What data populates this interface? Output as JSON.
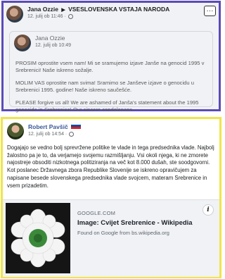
{
  "post1": {
    "author": "Jana Ozzie",
    "group": "VSESLOVENSKA VSTAJA NARODA",
    "arrow": "▶",
    "timestamp": "12. julij ob 11:46 ·",
    "more_label": "···",
    "shared": {
      "author": "Jana Ozzie",
      "timestamp": "12. julij ob 10:49",
      "paragraphs": [
        "PROSIM oprostite vsem nam! Mi se sramujemo izjave Janše na genocid 1995 v Srebrenici! Naše iskreno sožalje.",
        "MOLIM VAS oprostite nam svima! Sramimo se Janševe izjave o genocidu u Srebrenici 1995. godine! Naše iskreno saučešće.",
        "PLEASE forgive us all! We are ashamed of Janša's statement about the 1995 genocide in Srebrenica! Our sincere condolences."
      ]
    }
  },
  "post2": {
    "author": "Robert Pavšič",
    "timestamp": "12. julij ob 14:54 ·",
    "body": [
      "Dogajajo se vedno bolj sprevržene politike te vlade in tega predsednika vlade. Najbolj žalostno pa je to, da verjamejo svojemu razmišljanju. Vsi okoli njega, ki ne zmorete najostreje obsoditi nizkotnega politiziranja na več kot 8.000 dušah, ste soodgovorni.",
      "Kot poslanec Državnega zbora Republike Slovenije se iskreno opravičujem za napisane besede slovenskega predsednika vlade svojcem, materam Srebrenice in vsem prizadetim."
    ],
    "link": {
      "domain": "GOOGLE.COM",
      "title": "Image: Cvijet Srebrenice - Wikipedia",
      "description": "Found on Google from bs.wikipedia.org",
      "info_label": "i"
    }
  }
}
